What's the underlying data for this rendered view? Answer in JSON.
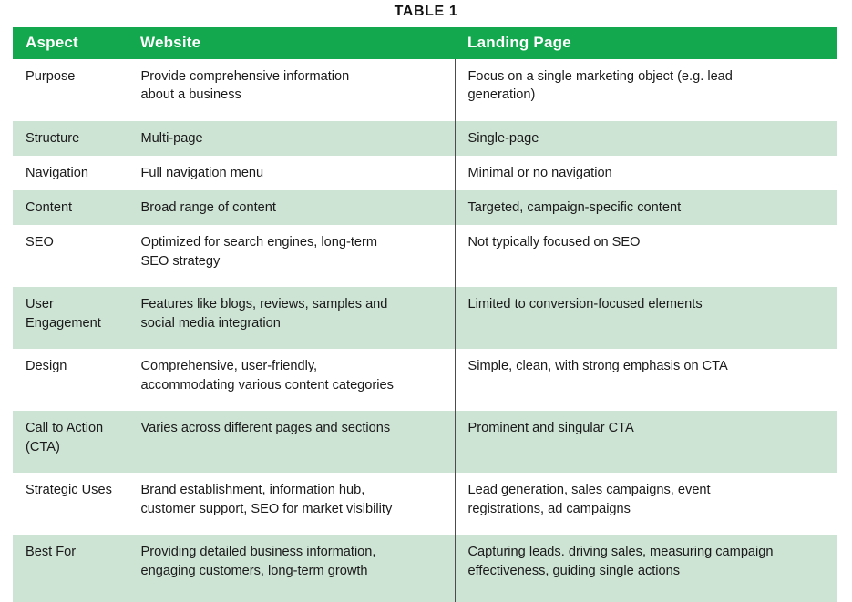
{
  "caption": "TABLE 1",
  "colors": {
    "header_green": "#14a84e",
    "stripe_green": "#cde3d4",
    "rule_gray": "#4c4c4c",
    "text": "#1a1a1a",
    "header_text": "#ffffff",
    "page_background": "#ffffff"
  },
  "table": {
    "headers": {
      "aspect": "Aspect",
      "website": "Website",
      "landing_page": "Landing Page"
    },
    "rows": [
      {
        "aspect": "Purpose",
        "website": "Provide comprehensive information\nabout a business",
        "landing_page": "Focus on a single marketing object (e.g. lead\ngeneration)"
      },
      {
        "aspect": "Structure",
        "website": "Multi-page",
        "landing_page": "Single-page"
      },
      {
        "aspect": "Navigation",
        "website": "Full navigation menu",
        "landing_page": "Minimal or no navigation"
      },
      {
        "aspect": "Content",
        "website": "Broad range of content",
        "landing_page": "Targeted, campaign-specific content"
      },
      {
        "aspect": "SEO",
        "website": "Optimized for search engines, long-term\nSEO strategy",
        "landing_page": "Not typically focused on SEO"
      },
      {
        "aspect": "User\nEngagement",
        "website": "Features like blogs, reviews, samples and\nsocial media integration",
        "landing_page": "Limited to conversion-focused elements"
      },
      {
        "aspect": "Design",
        "website": "Comprehensive, user-friendly,\naccommodating various content categories",
        "landing_page": "Simple, clean, with strong emphasis on CTA"
      },
      {
        "aspect": "Call to Action\n(CTA)",
        "website": "Varies across different pages and sections",
        "landing_page": "Prominent and singular CTA"
      },
      {
        "aspect": "Strategic Uses",
        "website": "Brand establishment, information hub,\ncustomer support, SEO for market visibility",
        "landing_page": "Lead generation, sales campaigns, event\nregistrations, ad campaigns"
      },
      {
        "aspect": "Best For",
        "website": "Providing detailed business information,\nengaging customers, long-term growth",
        "landing_page": "Capturing leads. driving sales, measuring campaign\neffectiveness, guiding single actions"
      }
    ]
  }
}
